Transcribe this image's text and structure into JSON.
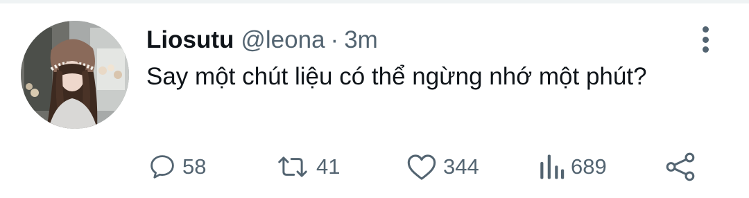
{
  "tweet": {
    "display_name": "Liosutu",
    "handle": "@leona",
    "separator": "·",
    "time": "3m",
    "text": "Say một chút liệu có thể ngừng nhớ một phút?"
  },
  "actions": {
    "reply": {
      "icon": "reply-icon",
      "count": "58"
    },
    "retweet": {
      "icon": "retweet-icon",
      "count": "41"
    },
    "like": {
      "icon": "heart-icon",
      "count": "344"
    },
    "views": {
      "icon": "views-icon",
      "count": "689"
    },
    "share": {
      "icon": "share-icon"
    }
  },
  "colors": {
    "text_primary": "#0f1419",
    "text_secondary": "#536471",
    "background": "#ffffff"
  }
}
